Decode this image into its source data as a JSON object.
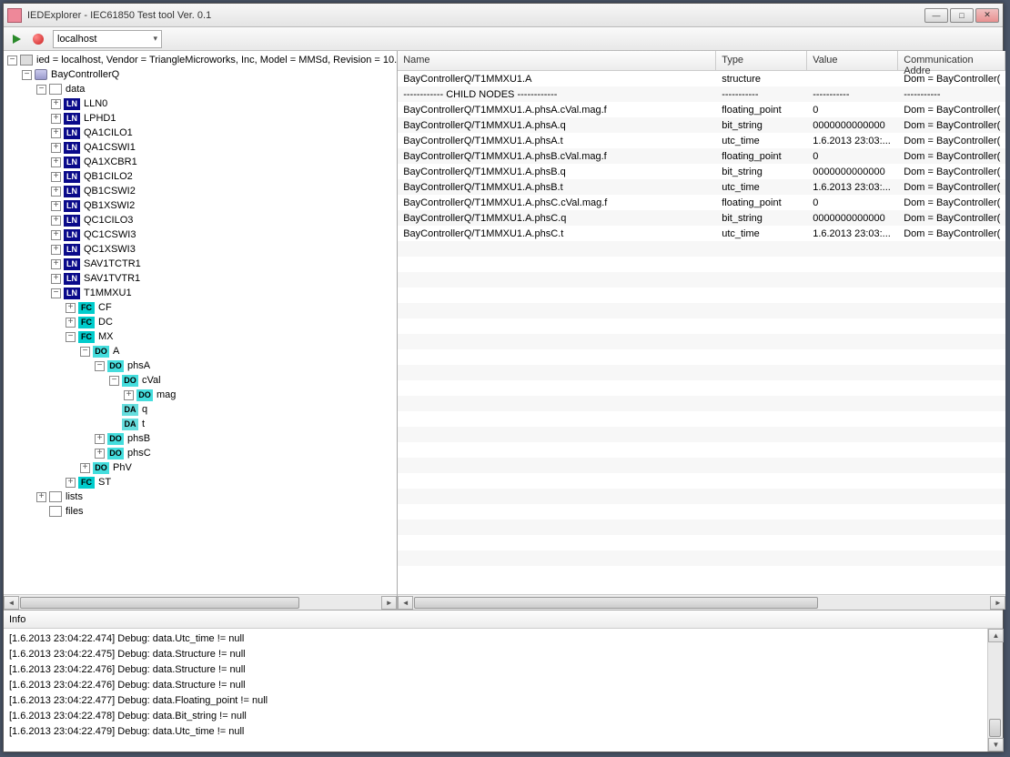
{
  "window": {
    "title": "IEDExplorer - IEC61850 Test tool Ver. 0.1"
  },
  "toolbar": {
    "host": "localhost"
  },
  "tree": {
    "root": "ied = localhost, Vendor = TriangleMicroworks, Inc, Model = MMSd, Revision = 10.",
    "controller": "BayControllerQ",
    "data": "data",
    "ln": [
      "LLN0",
      "LPHD1",
      "QA1CILO1",
      "QA1CSWI1",
      "QA1XCBR1",
      "QB1CILO2",
      "QB1CSWI2",
      "QB1XSWI2",
      "QC1CILO3",
      "QC1CSWI3",
      "QC1XSWI3",
      "SAV1TCTR1",
      "SAV1TVTR1",
      "T1MMXU1"
    ],
    "fc": [
      "CF",
      "DC",
      "MX",
      "ST"
    ],
    "do_a": "A",
    "phsA": "phsA",
    "cval": "cVal",
    "mag": "mag",
    "q": "q",
    "t": "t",
    "phsB": "phsB",
    "phsC": "phsC",
    "phv": "PhV",
    "lists": "lists",
    "files": "files"
  },
  "grid": {
    "headers": [
      "Name",
      "Type",
      "Value",
      "Communication Addre"
    ],
    "rows": [
      {
        "n": "BayControllerQ/T1MMXU1.A",
        "t": "structure",
        "v": "",
        "c": "Dom = BayController("
      },
      {
        "n": "------------ CHILD NODES ------------",
        "t": "-----------",
        "v": "-----------",
        "c": "-----------"
      },
      {
        "n": "BayControllerQ/T1MMXU1.A.phsA.cVal.mag.f",
        "t": "floating_point",
        "v": "0",
        "c": "Dom = BayController("
      },
      {
        "n": "BayControllerQ/T1MMXU1.A.phsA.q",
        "t": "bit_string",
        "v": "0000000000000",
        "c": "Dom = BayController("
      },
      {
        "n": "BayControllerQ/T1MMXU1.A.phsA.t",
        "t": "utc_time",
        "v": "1.6.2013 23:03:...",
        "c": "Dom = BayController("
      },
      {
        "n": "BayControllerQ/T1MMXU1.A.phsB.cVal.mag.f",
        "t": "floating_point",
        "v": "0",
        "c": "Dom = BayController("
      },
      {
        "n": "BayControllerQ/T1MMXU1.A.phsB.q",
        "t": "bit_string",
        "v": "0000000000000",
        "c": "Dom = BayController("
      },
      {
        "n": "BayControllerQ/T1MMXU1.A.phsB.t",
        "t": "utc_time",
        "v": "1.6.2013 23:03:...",
        "c": "Dom = BayController("
      },
      {
        "n": "BayControllerQ/T1MMXU1.A.phsC.cVal.mag.f",
        "t": "floating_point",
        "v": "0",
        "c": "Dom = BayController("
      },
      {
        "n": "BayControllerQ/T1MMXU1.A.phsC.q",
        "t": "bit_string",
        "v": "0000000000000",
        "c": "Dom = BayController("
      },
      {
        "n": "BayControllerQ/T1MMXU1.A.phsC.t",
        "t": "utc_time",
        "v": "1.6.2013 23:03:...",
        "c": "Dom = BayController("
      }
    ]
  },
  "log": {
    "header": "Info",
    "lines": [
      "[1.6.2013 23:04:22.474] Debug: data.Utc_time != null",
      "[1.6.2013 23:04:22.475] Debug: data.Structure != null",
      "[1.6.2013 23:04:22.476] Debug: data.Structure != null",
      "[1.6.2013 23:04:22.476] Debug: data.Structure != null",
      "[1.6.2013 23:04:22.477] Debug: data.Floating_point != null",
      "[1.6.2013 23:04:22.478] Debug: data.Bit_string != null",
      "[1.6.2013 23:04:22.479] Debug: data.Utc_time != null"
    ]
  }
}
